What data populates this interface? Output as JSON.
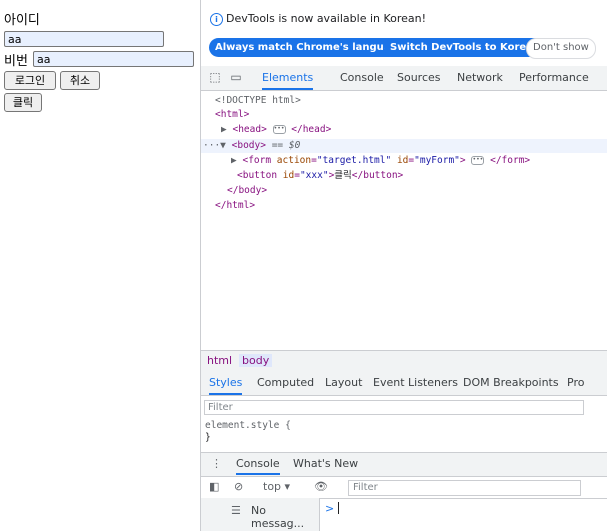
{
  "page": {
    "id_label": "아이디",
    "id_value": "aa",
    "pw_label": "비번",
    "pw_value": "aa",
    "login_button": "로그인",
    "cancel_button": "취소",
    "click_button": "클릭"
  },
  "devtools": {
    "info_icon": "i",
    "infobar_text": "DevTools is now available in Korean!",
    "lang_buttons": [
      "Always match Chrome's language",
      "Switch DevTools to Korean",
      "Don't show"
    ],
    "panel_tabs": [
      "Elements",
      "Console",
      "Sources",
      "Network",
      "Performance"
    ],
    "tree": {
      "doctype": "<!DOCTYPE html>",
      "html_open": "<html>",
      "head": "<head>",
      "head_close": "</head>",
      "body_open": "<body>",
      "body_eq": "== $0",
      "form_open": "<form ",
      "form_attr_action": "action",
      "form_val_action": "\"target.html\"",
      "form_attr_id": "id",
      "form_val_id": "\"myForm\"",
      "form_close": "</form>",
      "button_open": "<button ",
      "button_attr_id": "id",
      "button_val_id": "\"xxx\"",
      "button_text": "클릭",
      "button_close": "</button>",
      "body_close": "</body>",
      "html_close": "</html>"
    },
    "breadcrumbs": [
      "html",
      "body"
    ],
    "style_tabs": [
      "Styles",
      "Computed",
      "Layout",
      "Event Listeners",
      "DOM Breakpoints",
      "Pro"
    ],
    "filter_placeholder": "Filter",
    "element_style": "element.style {",
    "element_style_close": "}",
    "drawer_tabs": [
      "Console",
      "What's New"
    ],
    "console_context": "top",
    "console_filter": "Filter",
    "sidebar_item": "No messag...",
    "prompt": ">"
  }
}
